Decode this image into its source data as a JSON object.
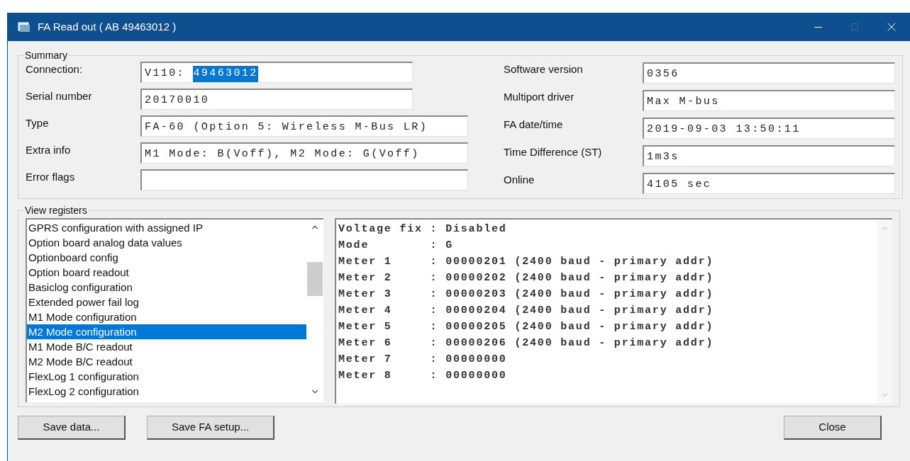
{
  "window": {
    "title": "FA Read out ( AB 49463012 )"
  },
  "summary": {
    "title": "Summary",
    "left": [
      {
        "label": "Connection:",
        "segments": [
          {
            "text": "V110: ",
            "selected": false
          },
          {
            "text": "49463012",
            "selected": true
          }
        ]
      },
      {
        "label": "Serial number",
        "segments": [
          {
            "text": "20170010",
            "selected": false
          }
        ]
      },
      {
        "label": "Type",
        "segments": [
          {
            "text": "FA-60 (Option 5: Wireless M-Bus LR)",
            "selected": false
          }
        ]
      },
      {
        "label": "Extra info",
        "segments": [
          {
            "text": "M1 Mode: B(Voff), M2 Mode: G(Voff)",
            "selected": false
          }
        ]
      },
      {
        "label": "Error flags"
      }
    ],
    "right": [
      {
        "label": "Software version",
        "value": "0356"
      },
      {
        "label": "Multiport driver",
        "value": "Max M-bus"
      },
      {
        "label": "FA date/time",
        "value": "2019-09-03 13:50:11"
      },
      {
        "label": "Time Difference (ST)",
        "value": "1m3s"
      },
      {
        "label": "Online",
        "value": "4105 sec"
      }
    ]
  },
  "registers": {
    "title": "View registers",
    "items": [
      {
        "label": "GPRS configuration with assigned IP",
        "selected": false
      },
      {
        "label": "Option board analog data values",
        "selected": false
      },
      {
        "label": "Optionboard config",
        "selected": false
      },
      {
        "label": "Option board readout",
        "selected": false
      },
      {
        "label": "Basiclog configuration",
        "selected": false
      },
      {
        "label": "Extended power fail log",
        "selected": false
      },
      {
        "label": "M1 Mode configuration",
        "selected": false
      },
      {
        "label": "M2 Mode configuration",
        "selected": true
      },
      {
        "label": "M1 Mode B/C readout",
        "selected": false
      },
      {
        "label": "M2 Mode B/C readout",
        "selected": false
      },
      {
        "label": "FlexLog 1 configuration",
        "selected": false
      },
      {
        "label": "FlexLog 2 configuration",
        "selected": false
      }
    ],
    "output": [
      "Voltage fix : Disabled",
      "Mode        : G",
      "Meter 1     : 00000201 (2400 baud - primary addr)",
      "Meter 2     : 00000202 (2400 baud - primary addr)",
      "Meter 3     : 00000203 (2400 baud - primary addr)",
      "Meter 4     : 00000204 (2400 baud - primary addr)",
      "Meter 5     : 00000205 (2400 baud - primary addr)",
      "Meter 6     : 00000206 (2400 baud - primary addr)",
      "Meter 7     : 00000000",
      "Meter 8     : 00000000"
    ]
  },
  "buttons": {
    "left": [
      "Save data...",
      "Save FA setup..."
    ],
    "right": [
      "Close"
    ]
  }
}
